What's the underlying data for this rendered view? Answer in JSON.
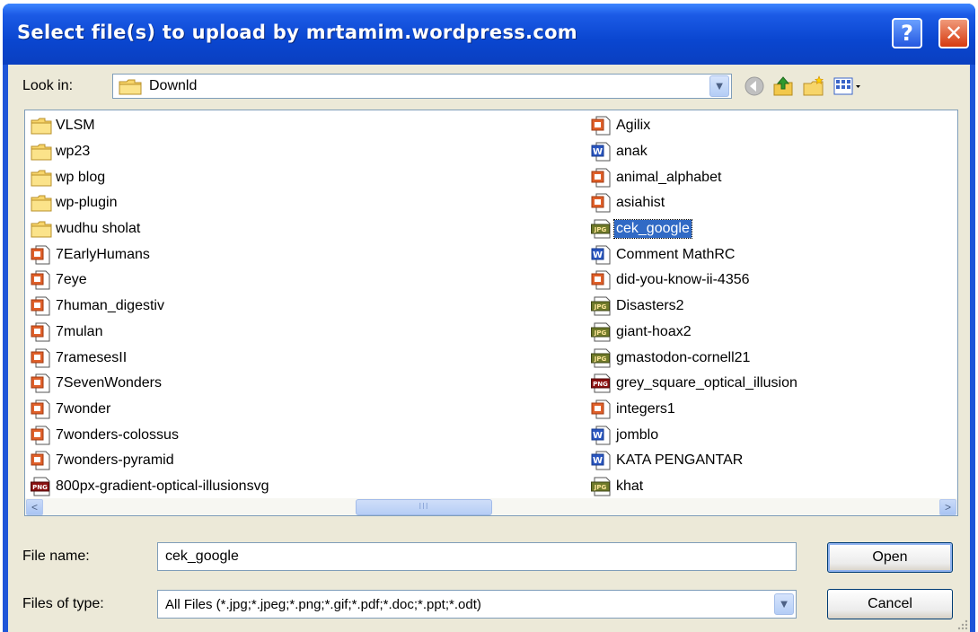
{
  "window": {
    "title": "Select file(s) to upload by mrtamim.wordpress.com",
    "help_label": "?",
    "close_label": "✕"
  },
  "lookin": {
    "label": "Look in:",
    "value": "Downld",
    "dropdown_icon": "chevron-down-icon"
  },
  "toolbar_icons": [
    "back-icon",
    "up-folder-icon",
    "new-folder-icon",
    "view-menu-icon"
  ],
  "files": {
    "column1": [
      {
        "name": "VLSM",
        "type": "folder"
      },
      {
        "name": "wp23",
        "type": "folder"
      },
      {
        "name": "wp blog",
        "type": "folder"
      },
      {
        "name": "wp-plugin",
        "type": "folder"
      },
      {
        "name": "wudhu sholat",
        "type": "folder"
      },
      {
        "name": "7EarlyHumans",
        "type": "ppt"
      },
      {
        "name": "7eye",
        "type": "ppt"
      },
      {
        "name": "7human_digestiv",
        "type": "ppt"
      },
      {
        "name": "7mulan",
        "type": "ppt"
      },
      {
        "name": "7ramesesII",
        "type": "ppt"
      },
      {
        "name": "7SevenWonders",
        "type": "ppt"
      },
      {
        "name": "7wonder",
        "type": "ppt"
      },
      {
        "name": "7wonders-colossus",
        "type": "ppt"
      },
      {
        "name": "7wonders-pyramid",
        "type": "ppt"
      },
      {
        "name": "800px-gradient-optical-illusionsvg",
        "type": "png"
      }
    ],
    "column2": [
      {
        "name": "Agilix",
        "type": "ppt"
      },
      {
        "name": "anak",
        "type": "doc"
      },
      {
        "name": "animal_alphabet",
        "type": "ppt"
      },
      {
        "name": "asiahist",
        "type": "ppt"
      },
      {
        "name": "cek_google",
        "type": "jpg",
        "selected": true
      },
      {
        "name": "Comment MathRC",
        "type": "doc"
      },
      {
        "name": "did-you-know-ii-4356",
        "type": "ppt"
      },
      {
        "name": "Disasters2",
        "type": "jpg"
      },
      {
        "name": "giant-hoax2",
        "type": "jpg"
      },
      {
        "name": "gmastodon-cornell21",
        "type": "jpg"
      },
      {
        "name": "grey_square_optical_illusion",
        "type": "png"
      },
      {
        "name": "integers1",
        "type": "ppt"
      },
      {
        "name": "jomblo",
        "type": "doc"
      },
      {
        "name": "KATA PENGANTAR",
        "type": "doc"
      },
      {
        "name": "khat",
        "type": "jpg"
      }
    ]
  },
  "scrollbar": {
    "left_arrow": "<",
    "right_arrow": ">",
    "thumb_grip": "III"
  },
  "filename": {
    "label": "File name:",
    "value": "cek_google"
  },
  "filetype": {
    "label": "Files of type:",
    "value": "All Files (*.jpg;*.jpeg;*.png;*.gif;*.pdf;*.doc;*.ppt;*.odt)"
  },
  "buttons": {
    "open_label": "Open",
    "cancel_label": "Cancel"
  },
  "icon_badges": {
    "doc": "W",
    "jpg": "JPG",
    "png": "PNG"
  },
  "colors": {
    "title_bar": "#0a46d0",
    "selection": "#316ac5",
    "dialog_bg": "#ece9d8"
  }
}
